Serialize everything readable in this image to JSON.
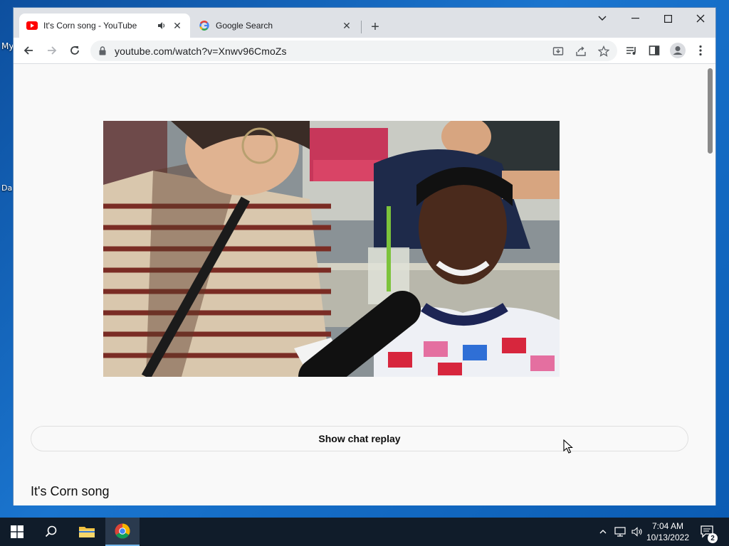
{
  "desktop": {
    "icons": [
      "My",
      "Da"
    ]
  },
  "browser": {
    "tabs": [
      {
        "title": "It's Corn song - YouTube",
        "favicon": "youtube-icon",
        "audio": true,
        "active": true
      },
      {
        "title": "Google Search",
        "favicon": "google-icon",
        "audio": false,
        "active": false
      }
    ],
    "url": "youtube.com/watch?v=Xnwv96CmoZs",
    "toolbar_icons": [
      "back-icon",
      "forward-icon",
      "reload-icon",
      "install-icon",
      "share-icon",
      "bookmark-star-icon",
      "reading-list-icon",
      "side-panel-icon",
      "profile-icon",
      "menu-icon"
    ]
  },
  "page": {
    "chat_button": "Show chat replay",
    "video_title": "It's Corn song"
  },
  "taskbar": {
    "time": "7:04 AM",
    "date": "10/13/2022",
    "notification_count": "2"
  },
  "colors": {
    "youtube_red": "#ff0000",
    "taskbar": "#101c2a",
    "desktop": "#1667b8"
  }
}
